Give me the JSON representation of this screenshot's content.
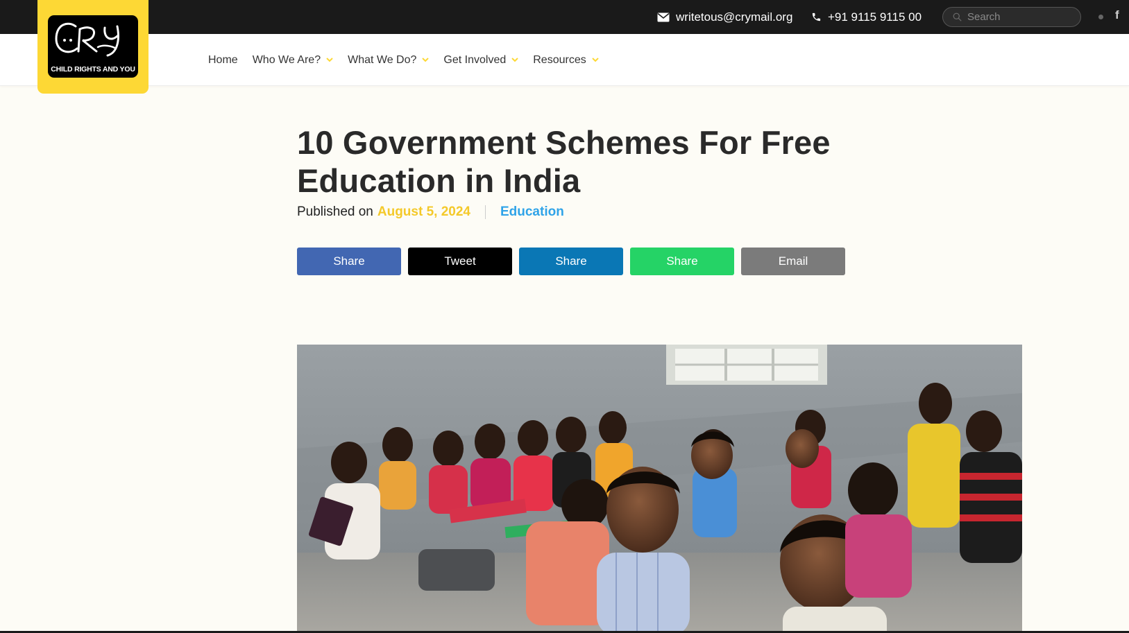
{
  "topbar": {
    "email": "writetous@crymail.org",
    "phone": "+91 9115 9115 00",
    "search_placeholder": "Search",
    "social_icon": "f"
  },
  "logo": {
    "wordmark": "CRY",
    "tagline": "CHILD RIGHTS AND YOU"
  },
  "nav": {
    "items": [
      {
        "label": "Home",
        "dropdown": false
      },
      {
        "label": "Who We Are?",
        "dropdown": true
      },
      {
        "label": "What We Do?",
        "dropdown": true
      },
      {
        "label": "Get Involved",
        "dropdown": true
      },
      {
        "label": "Resources",
        "dropdown": true
      }
    ]
  },
  "article": {
    "title": "10 Government Schemes For Free Education in India",
    "published_prefix": "Published on",
    "date": "August 5, 2024",
    "category": "Education"
  },
  "share_buttons": [
    {
      "label": "Share",
      "network": "facebook",
      "color": "#4267b2"
    },
    {
      "label": "Tweet",
      "network": "x",
      "color": "#000000"
    },
    {
      "label": "Share",
      "network": "linkedin",
      "color": "#0a77b5"
    },
    {
      "label": "Share",
      "network": "whatsapp",
      "color": "#25d366"
    },
    {
      "label": "Email",
      "network": "email",
      "color": "#7b7b7b"
    }
  ],
  "colors": {
    "brand_yellow": "#fdd835",
    "date_yellow": "#f4c92a",
    "category_blue": "#2fa3e8"
  }
}
